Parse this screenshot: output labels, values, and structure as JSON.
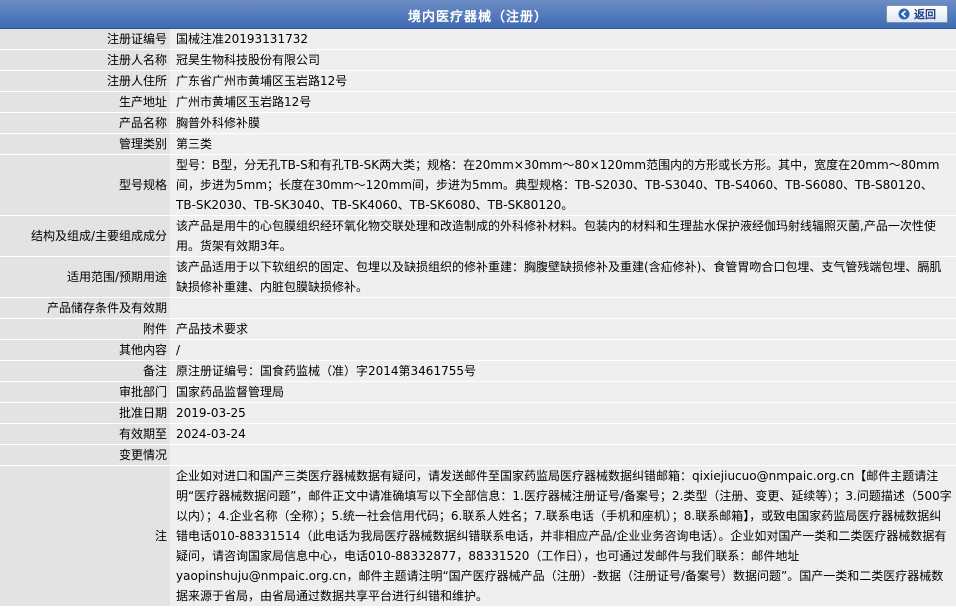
{
  "header": {
    "title": "境内医疗器械（注册）",
    "back_label": "返回"
  },
  "rows": [
    {
      "label": "注册证编号",
      "value": "国械注准20193131732"
    },
    {
      "label": "注册人名称",
      "value": "冠昊生物科技股份有限公司"
    },
    {
      "label": "注册人住所",
      "value": "广东省广州市黄埔区玉岩路12号"
    },
    {
      "label": "生产地址",
      "value": "广州市黄埔区玉岩路12号"
    },
    {
      "label": "产品名称",
      "value": "胸普外科修补膜"
    },
    {
      "label": "管理类别",
      "value": "第三类"
    },
    {
      "label": "型号规格",
      "value": "型号：B型，分无孔TB-S和有孔TB-SK两大类；规格：在20mm×30mm～80×120mm范围内的方形或长方形。其中，宽度在20mm～80mm间，步进为5mm；长度在30mm～120mm间，步进为5mm。典型规格：TB-S2030、TB-S3040、TB-S4060、TB-S6080、TB-S80120、TB-SK2030、TB-SK3040、TB-SK4060、TB-SK6080、TB-SK80120。"
    },
    {
      "label": "结构及组成/主要组成成分",
      "value": "该产品是用牛的心包膜组织经环氧化物交联处理和改造制成的外科修补材料。包装内的材料和生理盐水保护液经伽玛射线辐照灭菌,产品一次性使用。货架有效期3年。"
    },
    {
      "label": "适用范围/预期用途",
      "value": "该产品适用于以下软组织的固定、包埋以及缺损组织的修补重建：胸腹壁缺损修补及重建(含疝修补)、食管胃吻合口包埋、支气管残端包埋、膈肌缺损修补重建、内脏包膜缺损修补。"
    },
    {
      "label": "产品储存条件及有效期",
      "value": ""
    },
    {
      "label": "附件",
      "value": "产品技术要求"
    },
    {
      "label": "其他内容",
      "value": "/"
    },
    {
      "label": "备注",
      "value": "原注册证编号：国食药监械（准）字2014第3461755号"
    },
    {
      "label": "审批部门",
      "value": "国家药品监督管理局"
    },
    {
      "label": "批准日期",
      "value": "2019-03-25"
    },
    {
      "label": "有效期至",
      "value": "2024-03-24"
    },
    {
      "label": "变更情况",
      "value": ""
    }
  ],
  "note": {
    "label": "注",
    "value": "企业如对进口和国产三类医疗器械数据有疑问，请发送邮件至国家药监局医疗器械数据纠错邮箱：qixiejiucuo@nmpaic.org.cn【邮件主题请注明“医疗器械数据问题”，邮件正文中请准确填写以下全部信息：1.医疗器械注册证号/备案号；2.类型（注册、变更、延续等）；3.问题描述（500字以内）；4.企业名称（全称）；5.统一社会信用代码；6.联系人姓名；7.联系电话（手机和座机）；8.联系邮箱】，或致电国家药监局医疗器械数据纠错电话010-88331514（此电话为我局医疗器械数据纠错联系电话，并非相应产品/企业业务咨询电话）。企业如对国产一类和二类医疗器械数据有疑问，请咨询国家局信息中心，电话010-88332877，88331520（工作日），也可通过发邮件与我们联系：邮件地址yaopinshuju@nmpaic.org.cn，邮件主题请注明“国产医疗器械产品（注册）-数据（注册证号/备案号）数据问题”。国产一类和二类医疗器械数据来源于省局，由省局通过数据共享平台进行纠错和维护。"
  }
}
